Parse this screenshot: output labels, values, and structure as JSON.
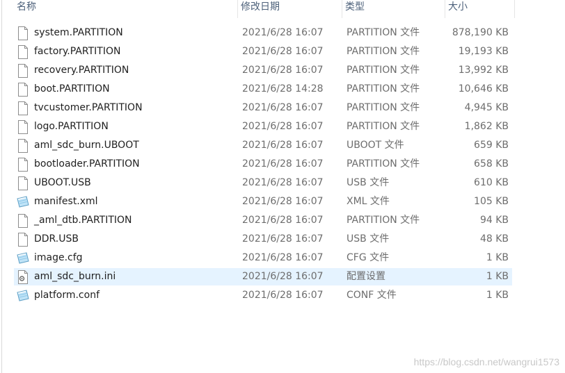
{
  "columns": {
    "name": "名称",
    "date": "修改日期",
    "type": "类型",
    "size": "大小"
  },
  "files": [
    {
      "name": "system.PARTITION",
      "date": "2021/6/28 16:07",
      "type": "PARTITION 文件",
      "size": "878,190 KB",
      "icon": "blank-file-icon",
      "selected": false
    },
    {
      "name": "factory.PARTITION",
      "date": "2021/6/28 16:07",
      "type": "PARTITION 文件",
      "size": "19,193 KB",
      "icon": "blank-file-icon",
      "selected": false
    },
    {
      "name": "recovery.PARTITION",
      "date": "2021/6/28 16:07",
      "type": "PARTITION 文件",
      "size": "13,992 KB",
      "icon": "blank-file-icon",
      "selected": false
    },
    {
      "name": "boot.PARTITION",
      "date": "2021/6/28 14:28",
      "type": "PARTITION 文件",
      "size": "10,646 KB",
      "icon": "blank-file-icon",
      "selected": false
    },
    {
      "name": "tvcustomer.PARTITION",
      "date": "2021/6/28 16:07",
      "type": "PARTITION 文件",
      "size": "4,945 KB",
      "icon": "blank-file-icon",
      "selected": false
    },
    {
      "name": "logo.PARTITION",
      "date": "2021/6/28 16:07",
      "type": "PARTITION 文件",
      "size": "1,862 KB",
      "icon": "blank-file-icon",
      "selected": false
    },
    {
      "name": "aml_sdc_burn.UBOOT",
      "date": "2021/6/28 16:07",
      "type": "UBOOT 文件",
      "size": "659 KB",
      "icon": "blank-file-icon",
      "selected": false
    },
    {
      "name": "bootloader.PARTITION",
      "date": "2021/6/28 16:07",
      "type": "PARTITION 文件",
      "size": "658 KB",
      "icon": "blank-file-icon",
      "selected": false
    },
    {
      "name": "UBOOT.USB",
      "date": "2021/6/28 16:07",
      "type": "USB 文件",
      "size": "610 KB",
      "icon": "blank-file-icon",
      "selected": false
    },
    {
      "name": "manifest.xml",
      "date": "2021/6/28 16:07",
      "type": "XML 文件",
      "size": "105 KB",
      "icon": "notepad-file-icon",
      "selected": false
    },
    {
      "name": "_aml_dtb.PARTITION",
      "date": "2021/6/28 16:07",
      "type": "PARTITION 文件",
      "size": "94 KB",
      "icon": "blank-file-icon",
      "selected": false
    },
    {
      "name": "DDR.USB",
      "date": "2021/6/28 16:07",
      "type": "USB 文件",
      "size": "48 KB",
      "icon": "blank-file-icon",
      "selected": false
    },
    {
      "name": "image.cfg",
      "date": "2021/6/28 16:07",
      "type": "CFG 文件",
      "size": "1 KB",
      "icon": "notepad-file-icon",
      "selected": false
    },
    {
      "name": "aml_sdc_burn.ini",
      "date": "2021/6/28 16:07",
      "type": "配置设置",
      "size": "1 KB",
      "icon": "settings-file-icon",
      "selected": true
    },
    {
      "name": "platform.conf",
      "date": "2021/6/28 16:07",
      "type": "CONF 文件",
      "size": "1 KB",
      "icon": "notepad-file-icon",
      "selected": false
    }
  ],
  "watermark": "https://blog.csdn.net/wangrui1573",
  "colors": {
    "header_text": "#4c607a",
    "secondary_text": "#6d6d6d",
    "selection": "#e5f3ff"
  }
}
